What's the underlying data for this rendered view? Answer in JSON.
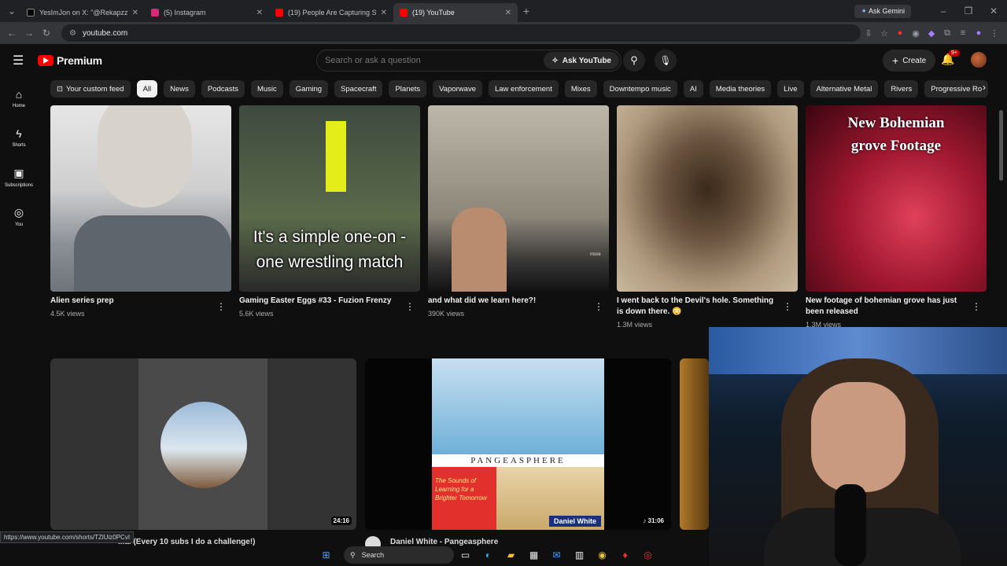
{
  "browser": {
    "tabs": [
      {
        "title": "YesImJon on X: \"@Rekapzz Bam",
        "favicon_color": "#000000"
      },
      {
        "title": "(5) Instagram",
        "favicon_color": "#d62976"
      },
      {
        "title": "(19) People Are Capturing Som",
        "favicon_color": "#ff0000"
      },
      {
        "title": "(19) YouTube",
        "favicon_color": "#ff0000"
      }
    ],
    "url": "youtube.com",
    "ask_gemini": "Ask Gemini"
  },
  "header": {
    "logo_text": "Premium",
    "search_placeholder": "Search or ask a question",
    "ask_youtube": "Ask YouTube",
    "create": "Create",
    "notification_count": "9+"
  },
  "sidebar": {
    "items": [
      {
        "label": "Home",
        "icon": "home-icon"
      },
      {
        "label": "Shorts",
        "icon": "shorts-icon"
      },
      {
        "label": "Subscriptions",
        "icon": "subscriptions-icon"
      },
      {
        "label": "You",
        "icon": "you-icon"
      }
    ]
  },
  "chips": [
    "Your custom feed",
    "All",
    "News",
    "Podcasts",
    "Music",
    "Gaming",
    "Spacecraft",
    "Planets",
    "Vaporwave",
    "Law enforcement",
    "Mixes",
    "Downtempo music",
    "AI",
    "Media theories",
    "Live",
    "Alternative Metal",
    "Rivers",
    "Progressive Ro"
  ],
  "selected_chip": "All",
  "videos_row1": [
    {
      "title": "Alien series prep",
      "views": "4.5K views"
    },
    {
      "title": "Gaming Easter Eggs #33 - Fuzion Frenzy",
      "views": "5.6K views",
      "overlay": "It's a simple one-on -one wrestling match"
    },
    {
      "title": "and what did we learn here?!",
      "views": "390K views"
    },
    {
      "title": "I went back to the Devil's hole.   Something is down there. 😳",
      "views": "1.3M views"
    },
    {
      "title": "New footage of bohemian grove has just been released",
      "views": "1.3M views",
      "overlay": "New Bohemian grove Footage"
    }
  ],
  "videos_row2": [
    {
      "duration": "24:16"
    },
    {
      "duration": "31:06",
      "caption_top": "PANGEASPHERE",
      "caption_left": "The Sounds of Learning for a Brighter Tomorrow",
      "brand": "Daniel White"
    }
  ],
  "row2_titles": {
    "left": "...al (Every 10 subs I do a challenge!)",
    "mid": "Daniel White - Pangeasphere"
  },
  "status_url": "https://www.youtube.com/shorts/TZlUiz0PCvI",
  "taskbar": {
    "search": "Search"
  }
}
